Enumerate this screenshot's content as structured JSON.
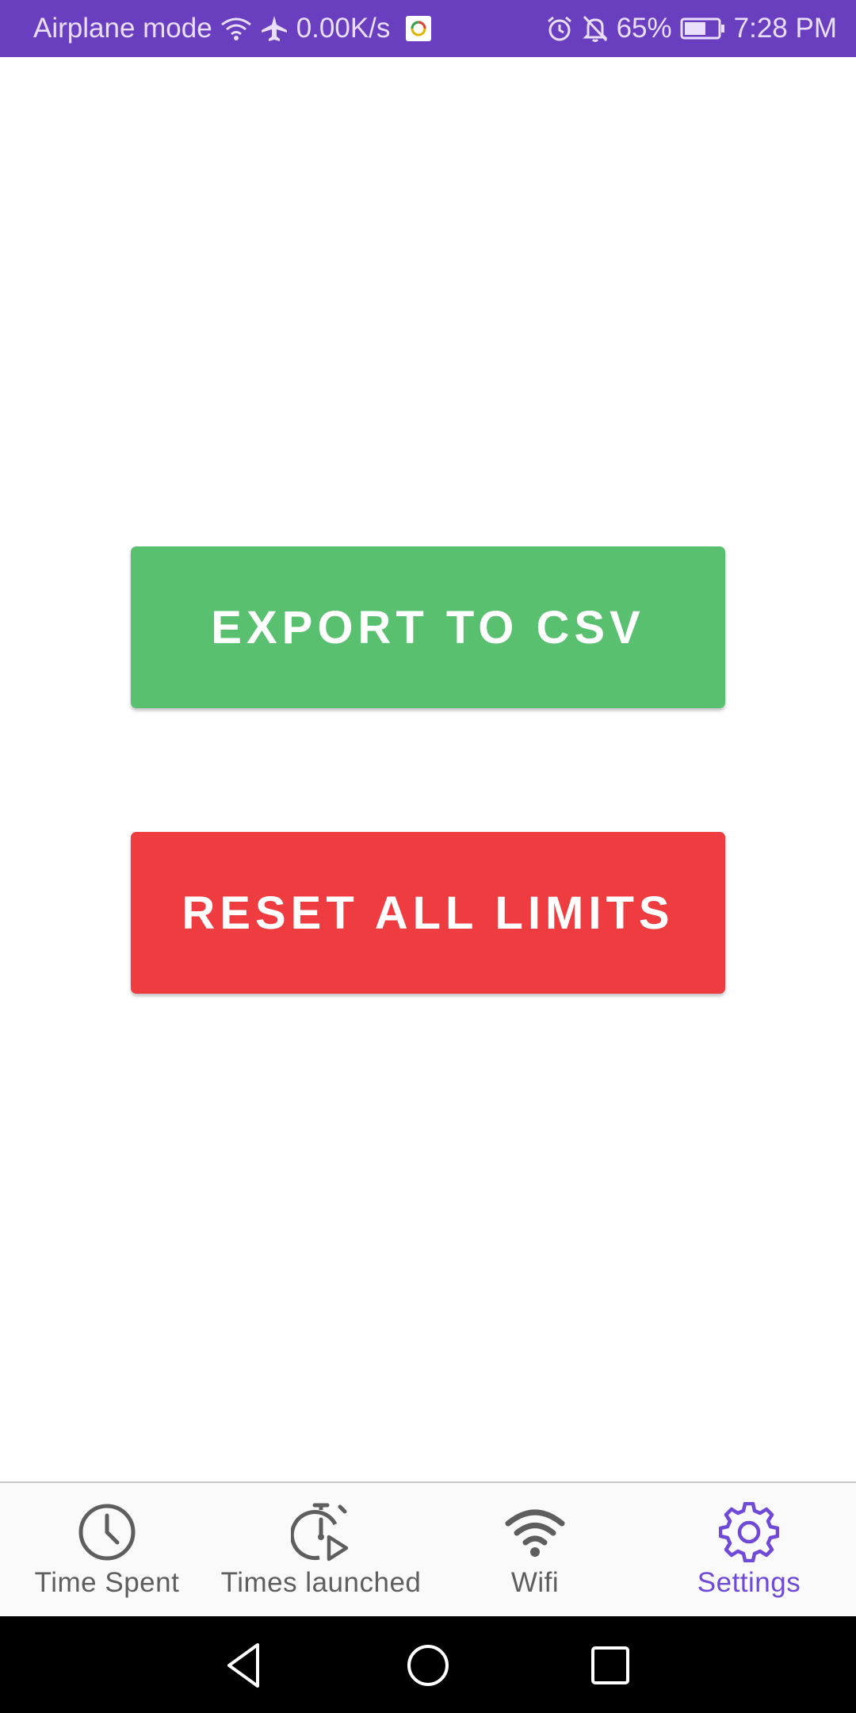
{
  "status_bar": {
    "carrier": "Airplane mode",
    "net_speed": "0.00K/s",
    "battery_percent": "65%",
    "battery_level": 0.65,
    "time": "7:28 PM",
    "icons": [
      "wifi-icon",
      "airplane-icon",
      "app-notification-icon",
      "alarm-icon",
      "bell-off-icon",
      "battery-icon"
    ]
  },
  "main": {
    "export_label": "EXPORT TO CSV",
    "reset_label": "RESET ALL LIMITS"
  },
  "bottom_nav": {
    "items": [
      {
        "label": "Time Spent",
        "icon": "clock-icon"
      },
      {
        "label": "Times launched",
        "icon": "timer-play-icon"
      },
      {
        "label": "Wifi",
        "icon": "wifi-icon"
      },
      {
        "label": "Settings",
        "icon": "gear-icon"
      }
    ],
    "active": "Settings"
  },
  "colors": {
    "status_bar": "#6a3fbf",
    "export_button": "#59c06f",
    "reset_button": "#ef3c40",
    "active_nav": "#6f4ad8",
    "inactive_nav": "#5e5e5e"
  },
  "system_nav": {
    "icons": [
      "back-icon",
      "home-icon",
      "recents-icon"
    ]
  }
}
